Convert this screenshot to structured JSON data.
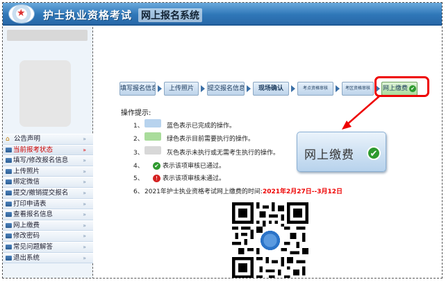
{
  "header": {
    "title": "护士执业资格考试",
    "subtitle": "网上报名系统"
  },
  "sidebar": {
    "items": [
      {
        "label": "公告声明",
        "icon": "home-icon",
        "active": false
      },
      {
        "label": "当前报考状态",
        "icon": "doc-icon",
        "active": true
      },
      {
        "label": "填写/修改报名信息",
        "icon": "doc-icon",
        "active": false
      },
      {
        "label": "上传照片",
        "icon": "doc-icon",
        "active": false
      },
      {
        "label": "绑定微信",
        "icon": "doc-icon",
        "active": false
      },
      {
        "label": "提交/撤销提交报名",
        "icon": "doc-icon",
        "active": false
      },
      {
        "label": "打印申请表",
        "icon": "doc-icon",
        "active": false
      },
      {
        "label": "查看报名信息",
        "icon": "doc-icon",
        "active": false
      },
      {
        "label": "网上缴费",
        "icon": "doc-icon",
        "active": false
      },
      {
        "label": "修改密码",
        "icon": "doc-icon",
        "active": false
      },
      {
        "label": "常见问题解答",
        "icon": "doc-icon",
        "active": false
      },
      {
        "label": "退出系统",
        "icon": "doc-icon",
        "active": false
      }
    ]
  },
  "steps": [
    {
      "label": "填写报名信息"
    },
    {
      "label": "上传照片"
    },
    {
      "label": "提交报名信息"
    },
    {
      "label": "现场确认"
    },
    {
      "label": "考点资格审核"
    },
    {
      "label": "考区资格审核"
    },
    {
      "label": "网上缴费"
    }
  ],
  "tips": {
    "title": "操作提示:",
    "items": [
      {
        "num": "1、",
        "text": "蓝色表示已完成的操作。"
      },
      {
        "num": "2、",
        "text": "绿色表示目前需要执行的操作。"
      },
      {
        "num": "3、",
        "text": "灰色表示未执行或无需考生执行的操作。"
      },
      {
        "num": "4、",
        "text": "表示该项审核已通过。"
      },
      {
        "num": "5、",
        "text": "表示该项审核未通过。"
      },
      {
        "num": "6、",
        "text": "2021年护士执业资格考试网上缴费的时间:",
        "highlight": "2021年2月27日--3月12日"
      }
    ]
  },
  "pay_button": {
    "label": "网上缴费"
  },
  "colors": {
    "done": "#b7d3ee",
    "current": "#a9dc9b",
    "inactive": "#d8d8d8",
    "accent_red": "#e00000"
  }
}
